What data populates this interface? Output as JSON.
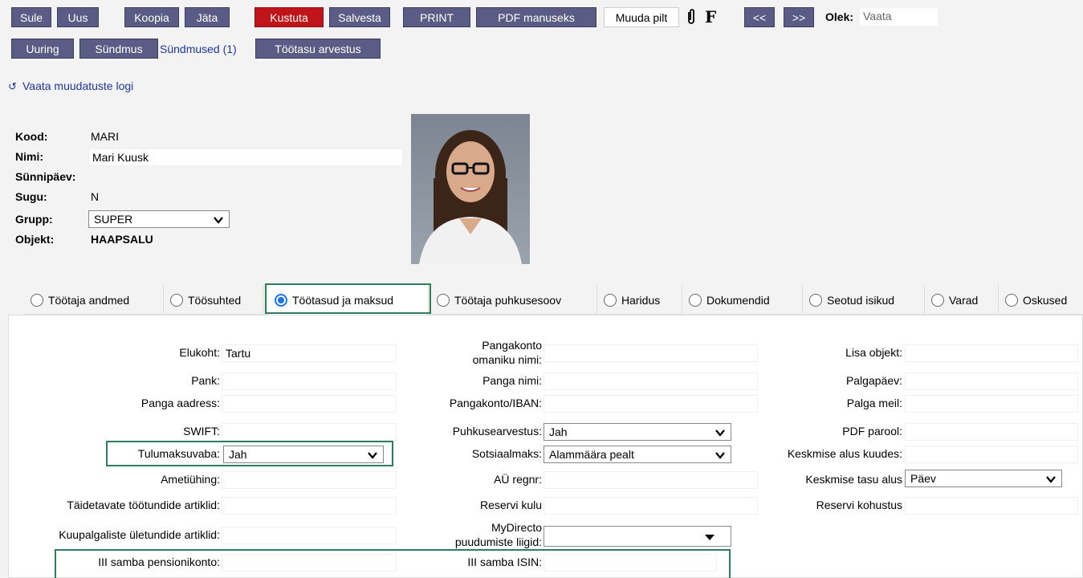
{
  "toolbar": {
    "row1": [
      "Sule",
      "Uus",
      "Koopia",
      "Jäta",
      "Kustuta",
      "Salvesta",
      "PRINT",
      "PDF manuseks"
    ],
    "change_image": "Muuda pilt",
    "clip_icon": "paperclip-icon",
    "f_label": "F",
    "prev": "<<",
    "next": ">>",
    "state_label": "Olek:",
    "state_value": "Vaata",
    "row2_uuring": "Uuring",
    "row2_sundmus": "Sündmus",
    "row2_sundmused_link": "Sündmused (1)",
    "row2_tootasu": "Töötasu arvestus"
  },
  "changelog": {
    "icon": "history-icon",
    "text": "Vaata muudatuste logi"
  },
  "employee": {
    "kood_label": "Kood:",
    "kood": "MARI",
    "nimi_label": "Nimi:",
    "nimi": "Mari Kuusk",
    "sunnipaev_label": "Sünnipäev:",
    "sugu_label": "Sugu:",
    "sugu": "N",
    "grupp_label": "Grupp:",
    "grupp": "SUPER",
    "objekt_label": "Objekt:",
    "objekt": "HAAPSALU"
  },
  "tabs": [
    "Töötaja andmed",
    "Töösuhted",
    "Töötasud ja maksud",
    "Töötaja puhkusesoov",
    "Haridus",
    "Dokumendid",
    "Seotud isikud",
    "Varad",
    "Oskused"
  ],
  "active_tab": "Töötasud ja maksud",
  "form": {
    "col1": [
      {
        "label": "Elukoht:",
        "value": "Tartu"
      },
      {
        "label": "Pank:",
        "value": ""
      },
      {
        "label": "Panga aadress:",
        "value": ""
      },
      {
        "label": "SWIFT:",
        "value": ""
      },
      {
        "label": "Tulumaksuvaba:",
        "value": "Jah"
      },
      {
        "label": "Ametiühing:",
        "value": ""
      },
      {
        "label": "Täidetavate töötundide artiklid:",
        "value": ""
      },
      {
        "label": "Kuupalgaliste ületundide artiklid:",
        "value": ""
      },
      {
        "label": "III samba pensionikonto:",
        "value": ""
      }
    ],
    "col2": [
      {
        "label_a": "Pangakonto",
        "label_b": "omaniku nimi:",
        "value": ""
      },
      {
        "label": "Panga nimi:",
        "value": ""
      },
      {
        "label": "Pangakonto/IBAN:",
        "value": ""
      },
      {
        "label": "Puhkusearvestus:",
        "value": "Jah"
      },
      {
        "label": "Sotsiaalmaks:",
        "value": "Alammäära pealt"
      },
      {
        "label": "AÜ regnr:",
        "value": ""
      },
      {
        "label": "Reservi kulu",
        "value": ""
      },
      {
        "label_a": "MyDirecto",
        "label_b": "puudumiste liigid:",
        "value": ""
      },
      {
        "label": "III samba ISIN:",
        "value": ""
      }
    ],
    "col3": [
      {
        "label": "Lisa objekt:",
        "value": ""
      },
      {
        "label": "Palgapäev:",
        "value": ""
      },
      {
        "label": "Palga meil:",
        "value": ""
      },
      {
        "label": "PDF parool:",
        "value": ""
      },
      {
        "label": "Keskmise alus kuudes:",
        "value": ""
      },
      {
        "label": "Keskmise tasu alus",
        "value": "Päev"
      },
      {
        "label": "Reservi kohustus",
        "value": ""
      }
    ]
  },
  "colors": {
    "button": "#5b5c86",
    "danger": "#c0141b",
    "highlight": "#2e7d5b",
    "link": "#1f35a5"
  }
}
